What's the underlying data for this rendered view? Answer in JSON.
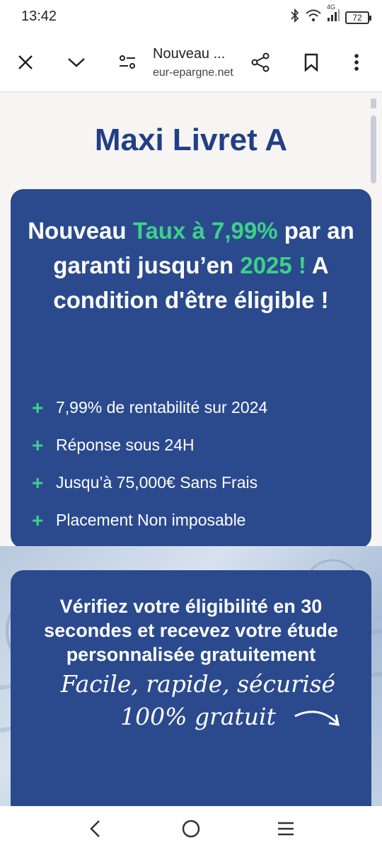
{
  "status_bar": {
    "time": "13:42",
    "network": "4G",
    "battery": "72",
    "icons": [
      "bluetooth-icon",
      "wifi-icon",
      "signal-icon",
      "battery-icon"
    ]
  },
  "browser": {
    "page_title": "Nouveau ...",
    "domain": "eur-epargne.net",
    "icons": [
      "close-icon",
      "chevron-down-icon",
      "site-settings-icon",
      "share-icon",
      "bookmark-icon",
      "more-icon"
    ]
  },
  "page": {
    "title": "Maxi Livret A",
    "offer": {
      "part1": "Nouveau ",
      "rate": "Taux à 7,99%",
      "part2": " par an garanti jusqu’en ",
      "year": "2025 !",
      "part3": " A condition d'être éligible !",
      "benefits": [
        "7,99% de rentabilité sur 2024",
        "Réponse sous 24H",
        "Jusqu’à 75,000€ Sans Frais",
        "Placement Non imposable"
      ]
    },
    "eligibility": {
      "text": "Vérifiez votre éligibilité en 30 secondes et recevez votre étude personnalisée gratuitement",
      "tagline_line1": "Facile, rapide, sécurisé",
      "tagline_line2": "100% gratuit"
    }
  },
  "colors": {
    "title_blue": "#223f85",
    "card_blue": "#2b4a8e",
    "accent_green": "#3cd18a"
  },
  "nav": {
    "icons": [
      "back-icon",
      "home-icon",
      "recents-icon"
    ]
  }
}
